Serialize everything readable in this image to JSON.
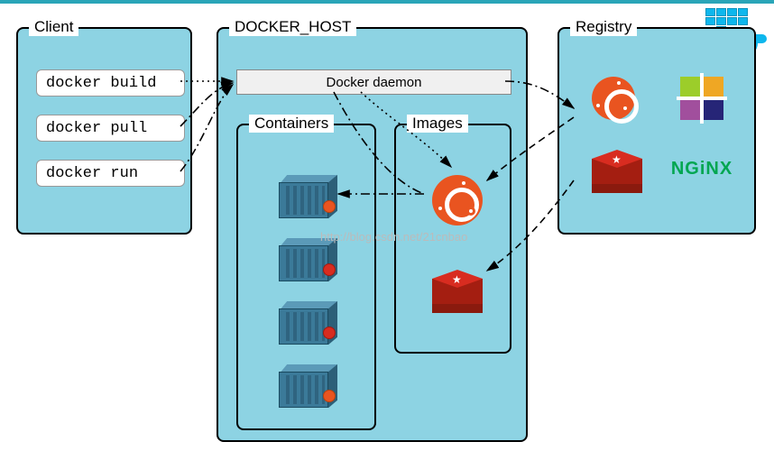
{
  "client": {
    "title": "Client",
    "commands": [
      "docker build",
      "docker pull",
      "docker run"
    ]
  },
  "host": {
    "title": "DOCKER_HOST",
    "daemon_label": "Docker daemon",
    "containers": {
      "title": "Containers"
    },
    "images": {
      "title": "Images"
    }
  },
  "registry": {
    "title": "Registry",
    "entries": [
      {
        "name": "ubuntu",
        "kind": "ubuntu"
      },
      {
        "name": "centos",
        "kind": "centos"
      },
      {
        "name": "redis",
        "kind": "redis"
      },
      {
        "name": "nginx",
        "kind": "nginx",
        "label": "NGiNX"
      }
    ]
  },
  "watermark": "http://blog.csdn.net/21cnbao",
  "colors": {
    "ubuntu": "#e95420",
    "redis": "#d82c20",
    "nginx": "#00a651",
    "panel": "#8dd3e3"
  }
}
